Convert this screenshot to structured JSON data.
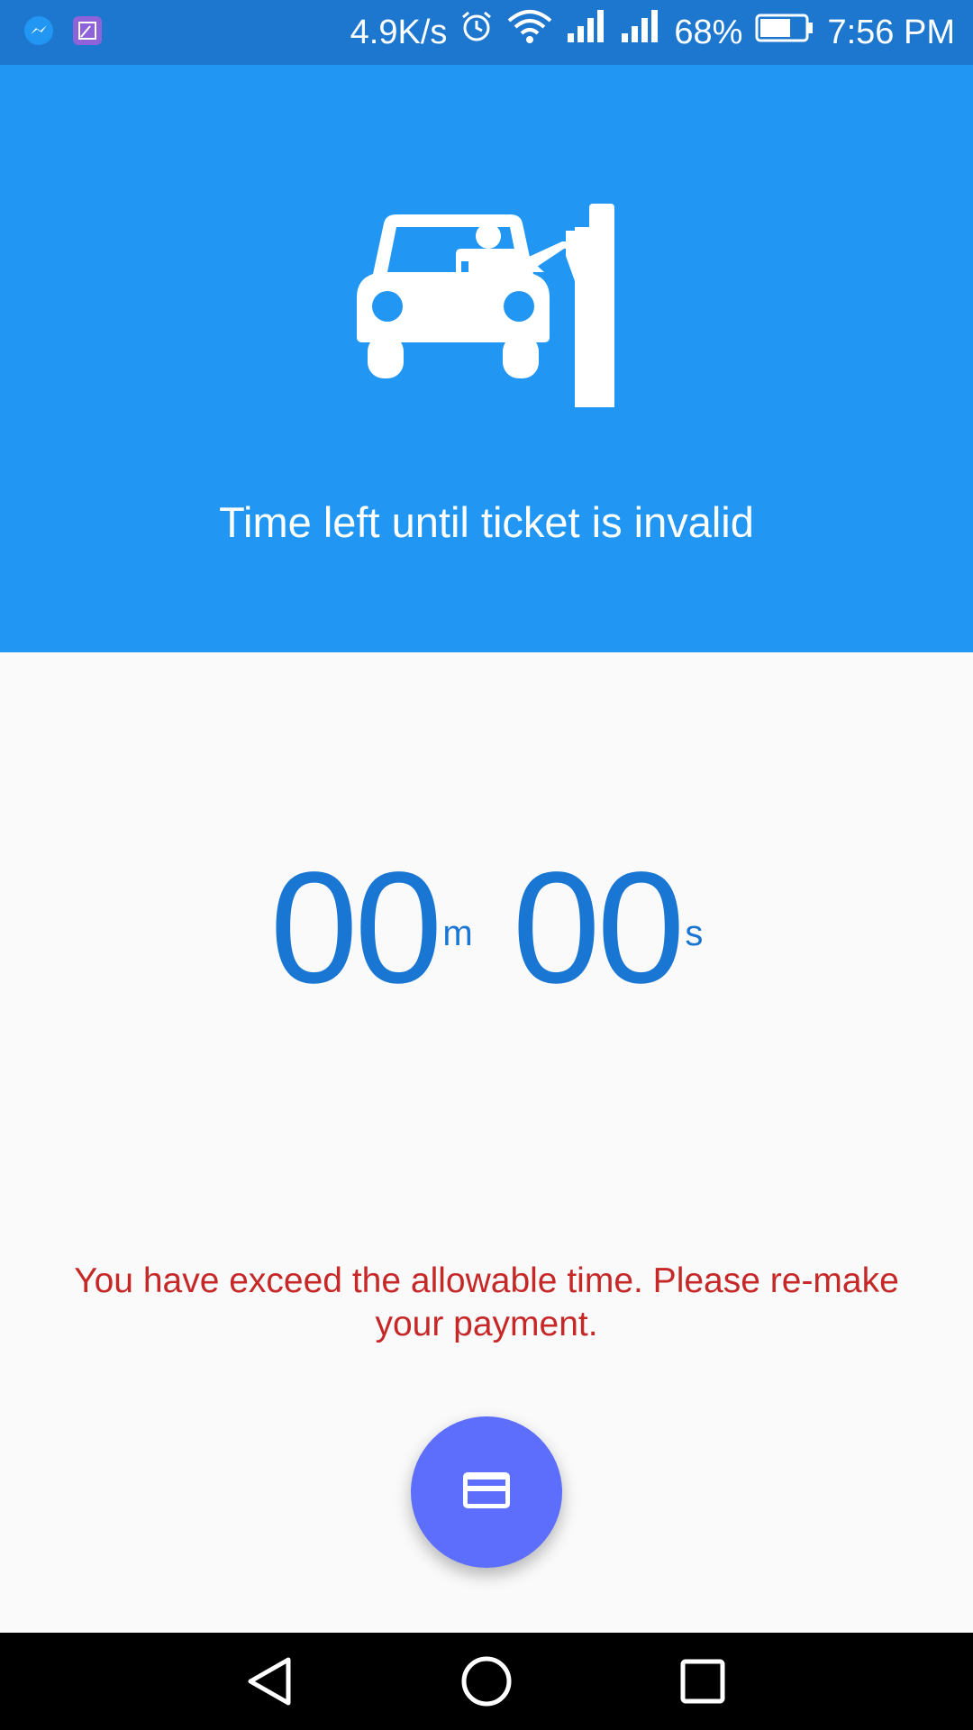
{
  "status_bar": {
    "network_speed": "4.9K/s",
    "battery_percent": "68%",
    "time": "7:56 PM",
    "battery_level": 0.68,
    "icons": [
      "messenger-icon",
      "gallery-icon",
      "alarm-icon",
      "wifi-icon",
      "signal-icon",
      "signal-icon",
      "battery-icon"
    ]
  },
  "header": {
    "title": "Time left until ticket is invalid",
    "icon": "car-parking-gate-icon",
    "background": "#2196F3"
  },
  "countdown": {
    "minutes": "00",
    "minutes_unit": "m",
    "seconds": "00",
    "seconds_unit": "s",
    "color": "#1976D2"
  },
  "message": {
    "text": "You have exceed the allowable time. Please re-make your payment.",
    "color": "#C62828"
  },
  "fab": {
    "icon": "credit-card-icon",
    "color": "#5C6EFB"
  },
  "nav_bar": {
    "buttons": [
      "back-icon",
      "home-icon",
      "recents-icon"
    ]
  }
}
